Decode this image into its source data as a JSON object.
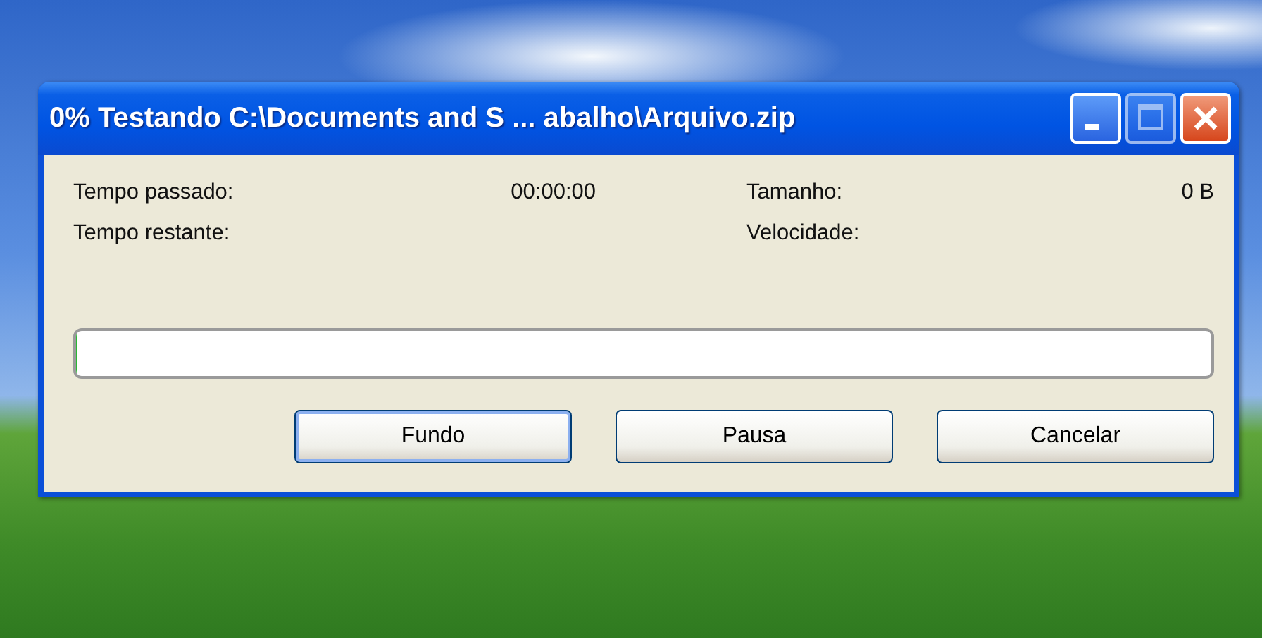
{
  "window": {
    "title": "0% Testando C:\\Documents and S ... abalho\\Arquivo.zip"
  },
  "stats": [
    {
      "label": "Tempo passado:",
      "value": "00:00:00"
    },
    {
      "label": "Tamanho:",
      "value": "0 B"
    },
    {
      "label": "Tempo restante:"
    },
    {
      "label": "Velocidade:"
    }
  ],
  "progress": {
    "level": 0
  },
  "buttons": [
    {
      "label": "Fundo",
      "default": true
    },
    {
      "label": "Pausa",
      "default": false
    },
    {
      "label": "Cancelar",
      "default": false
    }
  ]
}
